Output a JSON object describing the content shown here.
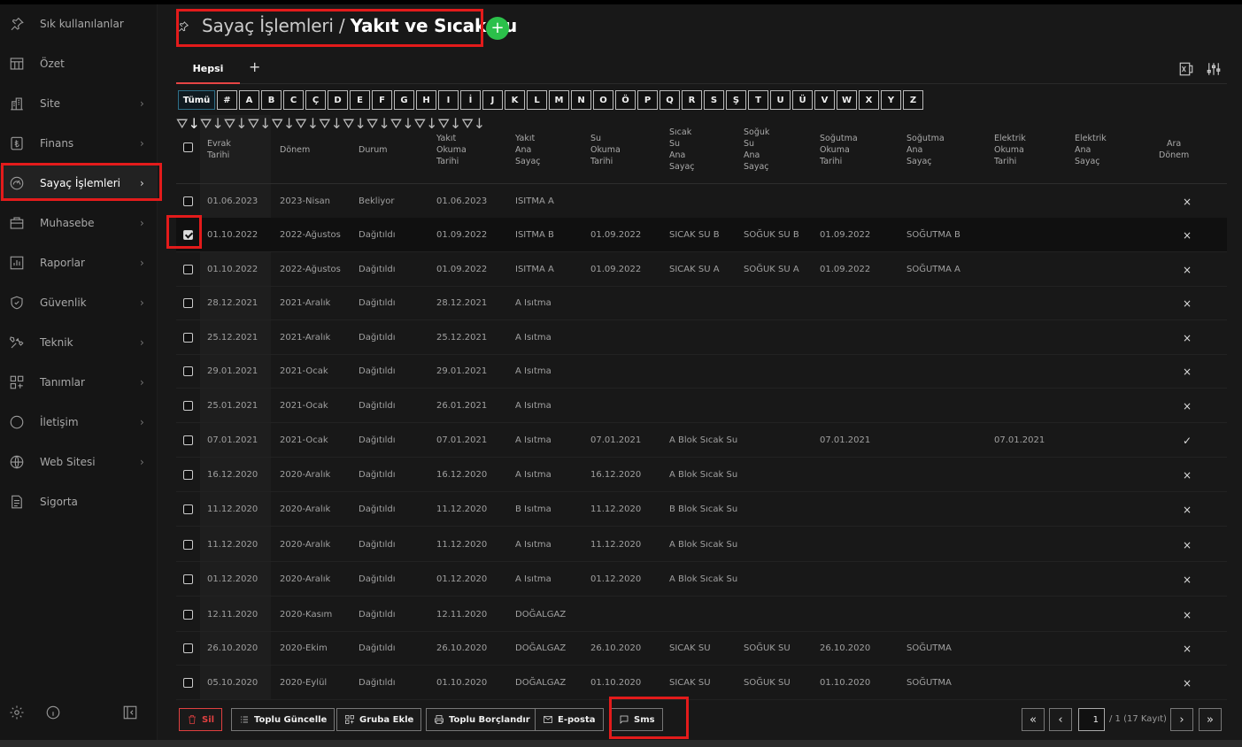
{
  "sidebar": {
    "items": [
      {
        "label": "Sık kullanılanlar",
        "icon": "pin-icon",
        "chevron": false
      },
      {
        "label": "Özet",
        "icon": "layout-icon",
        "chevron": false
      },
      {
        "label": "Site",
        "icon": "building-icon",
        "chevron": true
      },
      {
        "label": "Finans",
        "icon": "lira-icon",
        "chevron": true
      },
      {
        "label": "Sayaç İşlemleri",
        "icon": "gauge-icon",
        "chevron": true,
        "active": true
      },
      {
        "label": "Muhasebe",
        "icon": "briefcase-icon",
        "chevron": true
      },
      {
        "label": "Raporlar",
        "icon": "chart-icon",
        "chevron": true
      },
      {
        "label": "Güvenlik",
        "icon": "shield-icon",
        "chevron": true
      },
      {
        "label": "Teknik",
        "icon": "tools-icon",
        "chevron": true
      },
      {
        "label": "Tanımlar",
        "icon": "grid-plus-icon",
        "chevron": true
      },
      {
        "label": "İletişim",
        "icon": "chat-icon",
        "chevron": true
      },
      {
        "label": "Web Sitesi",
        "icon": "globe-icon",
        "chevron": true
      },
      {
        "label": "Sigorta",
        "icon": "document-icon",
        "chevron": false
      }
    ]
  },
  "header": {
    "title_prefix": "Sayaç İşlemleri / ",
    "title_main": "Yakıt ve Sıcak Su",
    "add_symbol": "+"
  },
  "tabs": {
    "active": "Hepsi",
    "add": "+"
  },
  "letters": [
    "Tümü",
    "#",
    "A",
    "B",
    "C",
    "Ç",
    "D",
    "E",
    "F",
    "G",
    "H",
    "I",
    "İ",
    "J",
    "K",
    "L",
    "M",
    "N",
    "O",
    "Ö",
    "P",
    "Q",
    "R",
    "S",
    "Ş",
    "T",
    "U",
    "Ü",
    "V",
    "W",
    "X",
    "Y",
    "Z"
  ],
  "columns": [
    "Evrak\nTarihi",
    "Dönem",
    "Durum",
    "Yakıt\nOkuma\nTarihi",
    "Yakıt\nAna\nSayaç",
    "Su\nOkuma\nTarihi",
    "Sıcak\nSu\nAna\nSayaç",
    "Soğuk\nSu\nAna\nSayaç",
    "Soğutma\nOkuma\nTarihi",
    "Soğutma\nAna\nSayaç",
    "Elektrik\nOkuma\nTarihi",
    "Elektrik\nAna\nSayaç",
    "Ara\nDönem"
  ],
  "rows": [
    {
      "checked": false,
      "c": [
        "01.06.2023",
        "2023-Nisan",
        "Bekliyor",
        "01.06.2023",
        "ISITMA A",
        "",
        "",
        "",
        "",
        "",
        "",
        ""
      ],
      "ara": "×"
    },
    {
      "checked": true,
      "c": [
        "01.10.2022",
        "2022-Ağustos",
        "Dağıtıldı",
        "01.09.2022",
        "ISITMA B",
        "01.09.2022",
        "SICAK SU B",
        "SOĞUK SU B",
        "01.09.2022",
        "SOĞUTMA B",
        "",
        ""
      ],
      "ara": "×"
    },
    {
      "checked": false,
      "c": [
        "01.10.2022",
        "2022-Ağustos",
        "Dağıtıldı",
        "01.09.2022",
        "ISITMA A",
        "01.09.2022",
        "SICAK SU A",
        "SOĞUK SU A",
        "01.09.2022",
        "SOĞUTMA A",
        "",
        ""
      ],
      "ara": "×"
    },
    {
      "checked": false,
      "c": [
        "28.12.2021",
        "2021-Aralık",
        "Dağıtıldı",
        "28.12.2021",
        "A Isıtma",
        "",
        "",
        "",
        "",
        "",
        "",
        ""
      ],
      "ara": "×"
    },
    {
      "checked": false,
      "c": [
        "25.12.2021",
        "2021-Aralık",
        "Dağıtıldı",
        "25.12.2021",
        "A Isıtma",
        "",
        "",
        "",
        "",
        "",
        "",
        ""
      ],
      "ara": "×"
    },
    {
      "checked": false,
      "c": [
        "29.01.2021",
        "2021-Ocak",
        "Dağıtıldı",
        "29.01.2021",
        "A Isıtma",
        "",
        "",
        "",
        "",
        "",
        "",
        ""
      ],
      "ara": "×"
    },
    {
      "checked": false,
      "c": [
        "25.01.2021",
        "2021-Ocak",
        "Dağıtıldı",
        "26.01.2021",
        "A Isıtma",
        "",
        "",
        "",
        "",
        "",
        "",
        ""
      ],
      "ara": "×"
    },
    {
      "checked": false,
      "c": [
        "07.01.2021",
        "2021-Ocak",
        "Dağıtıldı",
        "07.01.2021",
        "A Isıtma",
        "07.01.2021",
        "A Blok Sıcak Su",
        "",
        "07.01.2021",
        "",
        "07.01.2021",
        ""
      ],
      "ara": "✓"
    },
    {
      "checked": false,
      "c": [
        "16.12.2020",
        "2020-Aralık",
        "Dağıtıldı",
        "16.12.2020",
        "A Isıtma",
        "16.12.2020",
        "A Blok Sıcak Su",
        "",
        "",
        "",
        "",
        ""
      ],
      "ara": "×"
    },
    {
      "checked": false,
      "c": [
        "11.12.2020",
        "2020-Aralık",
        "Dağıtıldı",
        "11.12.2020",
        "B Isıtma",
        "11.12.2020",
        "B Blok Sıcak Su",
        "",
        "",
        "",
        "",
        ""
      ],
      "ara": "×"
    },
    {
      "checked": false,
      "c": [
        "11.12.2020",
        "2020-Aralık",
        "Dağıtıldı",
        "11.12.2020",
        "A Isıtma",
        "11.12.2020",
        "A Blok Sıcak Su",
        "",
        "",
        "",
        "",
        ""
      ],
      "ara": "×"
    },
    {
      "checked": false,
      "c": [
        "01.12.2020",
        "2020-Aralık",
        "Dağıtıldı",
        "01.12.2020",
        "A Isıtma",
        "01.12.2020",
        "A Blok Sıcak Su",
        "",
        "",
        "",
        "",
        ""
      ],
      "ara": "×"
    },
    {
      "checked": false,
      "c": [
        "12.11.2020",
        "2020-Kasım",
        "Dağıtıldı",
        "12.11.2020",
        "DOĞALGAZ",
        "",
        "",
        "",
        "",
        "",
        "",
        ""
      ],
      "ara": "×"
    },
    {
      "checked": false,
      "c": [
        "26.10.2020",
        "2020-Ekim",
        "Dağıtıldı",
        "26.10.2020",
        "DOĞALGAZ",
        "26.10.2020",
        "SICAK SU",
        "SOĞUK SU",
        "26.10.2020",
        "SOĞUTMA",
        "",
        ""
      ],
      "ara": "×"
    },
    {
      "checked": false,
      "c": [
        "05.10.2020",
        "2020-Eylül",
        "Dağıtıldı",
        "01.10.2020",
        "DOĞALGAZ",
        "01.10.2020",
        "SICAK SU",
        "SOĞUK SU",
        "01.10.2020",
        "SOĞUTMA",
        "",
        ""
      ],
      "ara": "×"
    }
  ],
  "actions": {
    "sil": "Sil",
    "toplu_guncelle": "Toplu Güncelle",
    "gruba_ekle": "Gruba Ekle",
    "toplu_borclandir": "Toplu Borçlandır",
    "eposta": "E-posta",
    "sms": "Sms"
  },
  "pagination": {
    "page": "1",
    "info": "/ 1 (17 Kayıt)"
  }
}
